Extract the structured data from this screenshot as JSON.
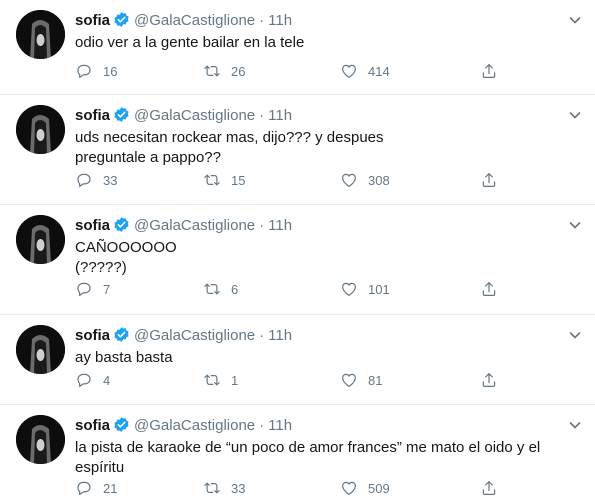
{
  "tweets": [
    {
      "author": "sofia",
      "handle": "@GalaCastiglione",
      "separator": "·",
      "time": "11h",
      "lines": [
        "odio ver a la gente bailar en la tele"
      ],
      "replies": "16",
      "retweets": "26",
      "likes": "414"
    },
    {
      "author": "sofia",
      "handle": "@GalaCastiglione",
      "separator": "·",
      "time": "11h",
      "lines": [
        "uds necesitan rockear mas, dijo??? y despues",
        "preguntale a pappo??"
      ],
      "replies": "33",
      "retweets": "15",
      "likes": "308"
    },
    {
      "author": "sofia",
      "handle": "@GalaCastiglione",
      "separator": "·",
      "time": "11h",
      "lines": [
        "CAÑOOOOOO",
        "(?????)"
      ],
      "replies": "7",
      "retweets": "6",
      "likes": "101"
    },
    {
      "author": "sofia",
      "handle": "@GalaCastiglione",
      "separator": "·",
      "time": "11h",
      "lines": [
        "ay basta basta"
      ],
      "replies": "4",
      "retweets": "1",
      "likes": "81"
    },
    {
      "author": "sofia",
      "handle": "@GalaCastiglione",
      "separator": "·",
      "time": "11h",
      "lines": [
        "la pista de karaoke de “un poco de amor frances” me mato el oido y el",
        "espíritu"
      ],
      "replies": "21",
      "retweets": "33",
      "likes": "509"
    }
  ],
  "icons": {
    "verified": "verified-badge-icon",
    "caret": "chevron-down-icon",
    "reply": "reply-icon",
    "retweet": "retweet-icon",
    "like": "heart-icon",
    "share": "share-icon"
  },
  "colors": {
    "verified": "#1da1f2",
    "muted": "#657786",
    "text": "#14171a",
    "divider": "#e6ecf0"
  }
}
